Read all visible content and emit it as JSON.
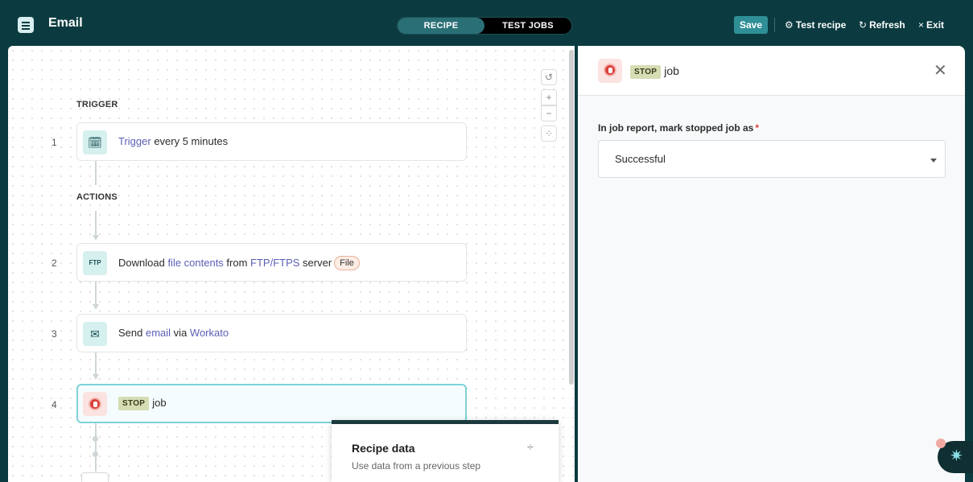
{
  "header": {
    "app_title": "Email",
    "tabs": [
      {
        "label": "RECIPE",
        "active": true
      },
      {
        "label": "TEST JOBS",
        "active": false
      }
    ],
    "save_label": "Save",
    "test_recipe_label": "Test recipe",
    "refresh_label": "Refresh",
    "exit_label": "Exit"
  },
  "canvas": {
    "trigger_label": "TRIGGER",
    "actions_label": "ACTIONS",
    "steps": [
      {
        "number": "1",
        "parts": {
          "a": "Trigger",
          "b": " every 5 minutes"
        },
        "icon": "calendar-clock-icon"
      },
      {
        "number": "2",
        "parts": {
          "a": "Download ",
          "b": "file contents",
          "c": " from ",
          "d": "FTP/FTPS",
          "e": " server",
          "pill": "File"
        },
        "icon": "ftp-icon"
      },
      {
        "number": "3",
        "parts": {
          "a": "Send ",
          "b": "email",
          "c": " via ",
          "d": "Workato"
        },
        "icon": "envelope-icon"
      },
      {
        "number": "4",
        "badge": "STOP",
        "text": "job",
        "icon": "stop-hand-icon"
      }
    ]
  },
  "recipe_data": {
    "title": "Recipe data",
    "subtitle": "Use data from a previous step"
  },
  "side_panel": {
    "badge": "STOP",
    "title": "job",
    "field_label": "In job report, mark stopped job as",
    "required_mark": "*",
    "selected_value": "Successful"
  },
  "colors": {
    "header_bg": "#0b3b40",
    "accent": "#2f8f96",
    "link": "#5b5fb5",
    "stop_red": "#d9413a"
  }
}
